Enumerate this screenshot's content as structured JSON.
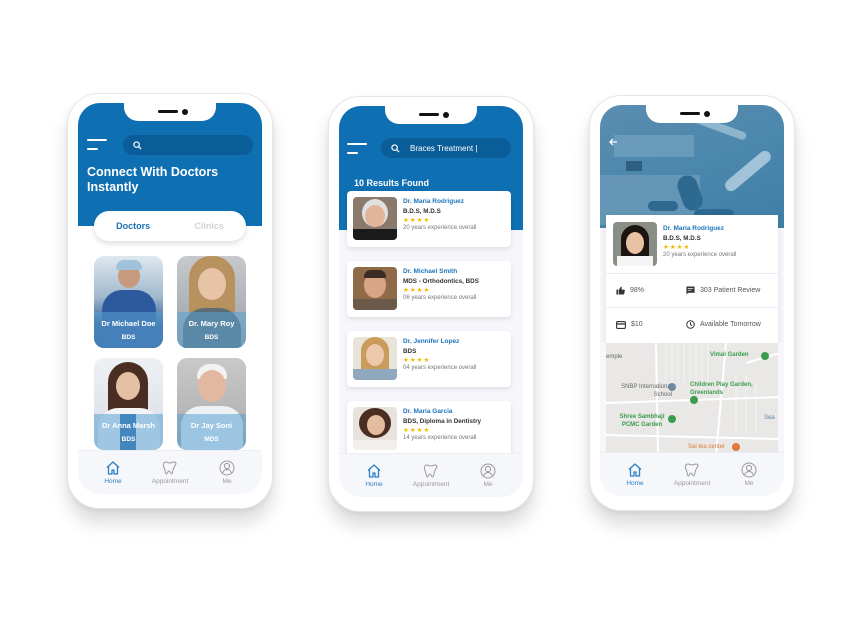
{
  "theme": {
    "primary": "#0f6fb3",
    "link": "#1d74bd",
    "star": "#f5b800",
    "inactive": "#9a9a9a"
  },
  "tabbar": {
    "items": [
      {
        "icon": "home-icon",
        "label": "Home"
      },
      {
        "icon": "tooth-icon",
        "label": "Appointment"
      },
      {
        "icon": "profile-icon",
        "label": "Me"
      }
    ]
  },
  "home_screen": {
    "search_placeholder": "",
    "title": "Connect With Doctors Instantly",
    "segment": {
      "active": "Doctors",
      "inactive": "Clinics"
    },
    "doctors": [
      {
        "name": "Dr Michael Doe",
        "degree": "BDS"
      },
      {
        "name": "Dr. Mary Roy",
        "degree": "BDS"
      },
      {
        "name": "Dr Anna Marsh",
        "degree": "BDS"
      },
      {
        "name": "Dr Jay Soni",
        "degree": "MDS"
      }
    ]
  },
  "search_screen": {
    "search_value": "Braces Treatment |",
    "results_count": "10 Results Found",
    "results": [
      {
        "name": "Dr. Maria Rodriguez",
        "degree": "B.D.S, M.D.S",
        "stars": "★★★★",
        "rating": 4,
        "experience": "20 years experience overall"
      },
      {
        "name": "Dr. Michael Smith",
        "degree": "MDS - Orthodontics, BDS",
        "stars": "★★★★",
        "rating": 4,
        "experience": "06 years experience overall"
      },
      {
        "name": "Dr. Jennifer Lopez",
        "degree": "BDS",
        "stars": "★★★★",
        "rating": 4,
        "experience": "04 years experience overall"
      },
      {
        "name": "Dr. Maria Garcia",
        "degree": "BDS, Diploma in Dentistry",
        "stars": "★★★★",
        "rating": 4,
        "experience": "14 years experience overall"
      }
    ]
  },
  "detail_screen": {
    "doctor": {
      "name": "Dr. Maria Rodriguez",
      "degree": "B.D.S, M.D.S",
      "stars": "★★★★",
      "rating": 4,
      "experience": "20 years experience overall"
    },
    "approval": "98%",
    "reviews": "303 Patient Review",
    "fee": "$10",
    "availability": "Available Tomorrow",
    "map_labels": {
      "temple": "emple",
      "vimal": "Vimal Garden",
      "snbp": "SNBP International School",
      "children": "Children Play Garden, Greenlands",
      "shree": "Shree Sambhaji PCMC Garden",
      "sai": "Sai tea center",
      "sea": "Sea"
    }
  }
}
